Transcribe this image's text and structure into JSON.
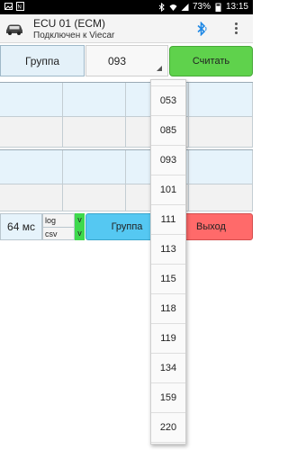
{
  "status_bar": {
    "battery_text": "73%",
    "time": "13:15",
    "left_icons": [
      "image-icon",
      "nfc-icon"
    ],
    "right_icons": [
      "bluetooth-icon",
      "wifi-icon",
      "signal-icon",
      "battery-icon"
    ]
  },
  "app_bar": {
    "title": "ECU 01 (ECM)",
    "subtitle": "Подключен к Viecar",
    "icons": [
      "car-icon",
      "bluetooth-icon",
      "more-vert-icon"
    ],
    "accent_color": "#1e88e5"
  },
  "toolbar": {
    "group_label": "Группа",
    "group_value": "093",
    "read_button": "Считать",
    "read_color": "#5fd24c"
  },
  "bottom_bar": {
    "interval": "64 мс",
    "log_label": "log",
    "csv_label": "csv",
    "log_flag": "v",
    "csv_flag": "v",
    "group_button": "Группа",
    "exit_button": "Выход",
    "group_color": "#55c8f2",
    "exit_color": "#ff6a6a"
  },
  "dropdown": {
    "options": [
      "053",
      "085",
      "093",
      "101",
      "111",
      "113",
      "115",
      "118",
      "119",
      "134",
      "159",
      "220"
    ]
  }
}
